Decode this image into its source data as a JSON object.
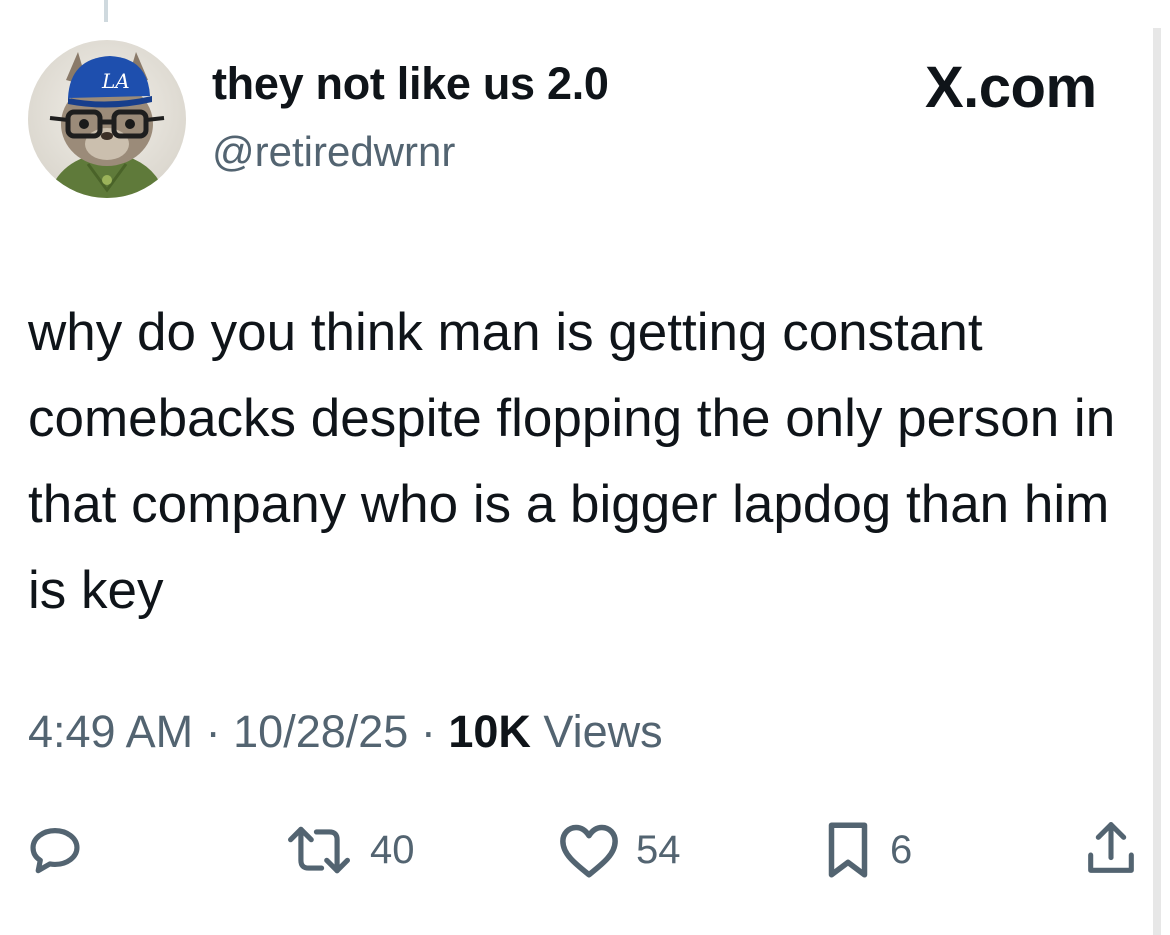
{
  "author": {
    "display_name": "they not like us 2.0",
    "handle": "@retiredwrnr",
    "avatar_icon": "avatar-image-squirrel-with-la-cap",
    "cap_logo_text": "LA"
  },
  "source": {
    "label": "X.com"
  },
  "tweet": {
    "text": "why do you think man is getting constant comebacks despite flopping the only person in that company who is a bigger lapdog than him is key"
  },
  "meta": {
    "time": "4:49 AM",
    "separator": "·",
    "date": "10/28/25",
    "views_count": "10K",
    "views_label": "Views"
  },
  "actions": {
    "reply": {
      "icon": "reply-icon",
      "count": ""
    },
    "retweet": {
      "icon": "retweet-icon",
      "count": "40"
    },
    "like": {
      "icon": "heart-icon",
      "count": "54"
    },
    "bookmark": {
      "icon": "bookmark-icon",
      "count": "6"
    },
    "share": {
      "icon": "share-icon",
      "count": ""
    }
  },
  "colors": {
    "text_primary": "#0f1419",
    "text_secondary": "#536471",
    "cap_blue": "#1e4fae"
  }
}
